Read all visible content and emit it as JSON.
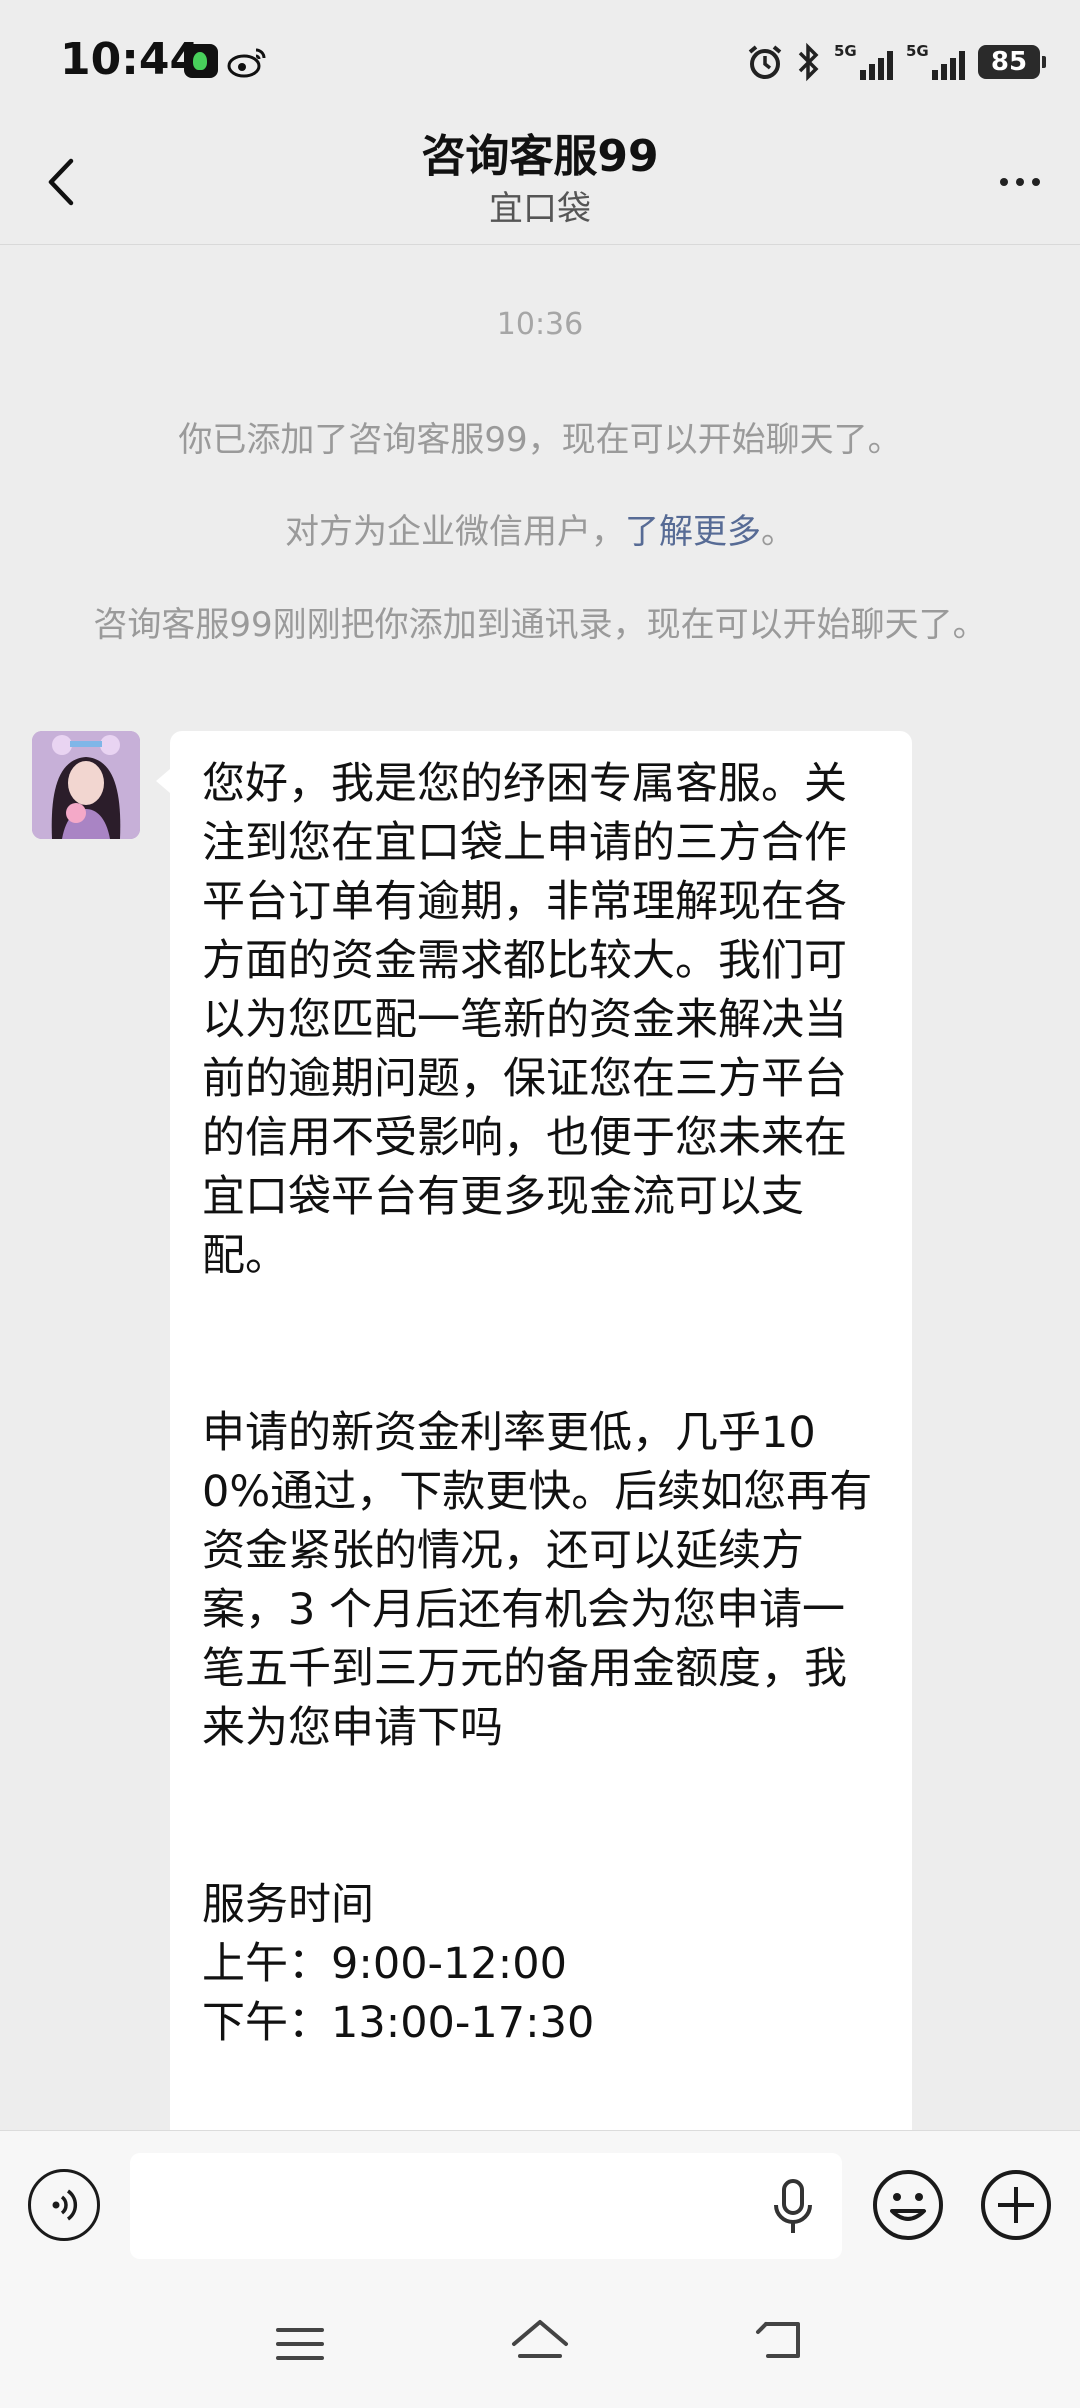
{
  "status_bar": {
    "time": "10:44",
    "network1": "5G",
    "network2": "5G",
    "battery": "85"
  },
  "header": {
    "title": "咨询客服99",
    "subtitle": "宜口袋"
  },
  "chat": {
    "timestamp": "10:36",
    "system_messages": {
      "added": "你已添加了咨询客服99，现在可以开始聊天了。",
      "enterprise_prefix": "对方为企业微信用户，",
      "enterprise_link": "了解更多",
      "enterprise_suffix": "。",
      "contact": "咨询客服99刚刚把你添加到通讯录，现在可以开始聊天了。"
    },
    "message": {
      "text": "您好，我是您的纾困专属客服。关注到您在宜口袋上申请的三方合作平台订单有逾期，非常理解现在各方面的资金需求都比较大。我们可以为您匹配一笔新的资金来解决当前的逾期问题，保证您在三方平台的信用不受影响，也便于您未来在宜口袋平台有更多现金流可以支配。\n\n\n申请的新资金利率更低，几乎100%通过，下款更快。后续如您再有资金紧张的情况，还可以延续方案，3 个月后还有机会为您申请一笔五千到三万元的备用金额度，我来为您申请下吗\n\n\n服务时间\n上午：9:00-12:00\n下午：13:00-17:30"
    }
  },
  "input": {
    "value": "",
    "placeholder": ""
  },
  "colors": {
    "background": "#ededed",
    "bubble_other": "#ffffff",
    "bubble_self": "#95ec69",
    "link": "#576b95"
  }
}
